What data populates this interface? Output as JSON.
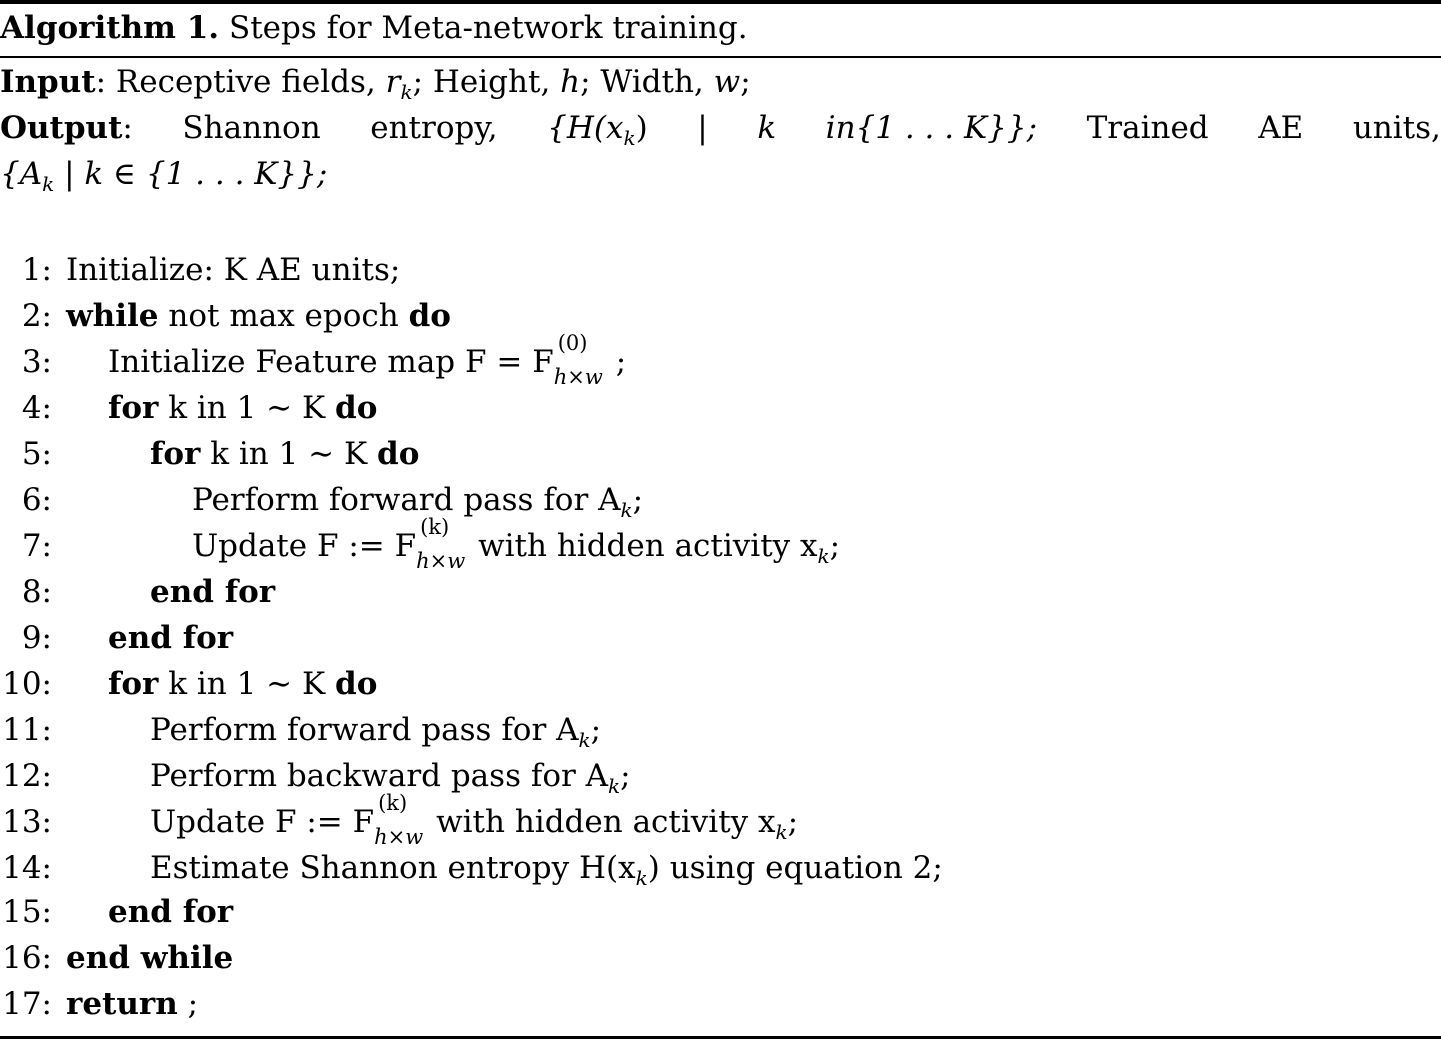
{
  "caption": {
    "label": "Algorithm 1.",
    "text": "Steps for Meta-network training."
  },
  "input": {
    "label": "Input",
    "parts": [
      "Receptive fields,",
      "r",
      "k",
      "; Height,",
      "h",
      "; Width,",
      "w",
      ";"
    ]
  },
  "output": {
    "label": "Output",
    "line1": [
      "Shannon",
      "entropy,",
      "{H(x",
      "k",
      ")",
      "|",
      "k",
      "in{1 . . . K}};",
      "Trained",
      "AE",
      "units,"
    ],
    "line2": [
      "{A",
      "k",
      "| k ∈ {1 . . . K}};"
    ]
  },
  "steps": [
    {
      "num": "1:",
      "text": "Initialize: K AE units;"
    },
    {
      "num": "2:",
      "kw1": "while",
      "text": "not max epoch",
      "kw2": "do"
    },
    {
      "num": "3:",
      "text": "Initialize Feature map F = F",
      "sup": "(0)",
      "sub": "h×w",
      "tail": ";"
    },
    {
      "num": "4:",
      "kw1": "for",
      "text": "k in 1 ∼ K",
      "kw2": "do"
    },
    {
      "num": "5:",
      "kw1": "for",
      "text": "k in 1 ∼ K",
      "kw2": "do"
    },
    {
      "num": "6:",
      "text": "Perform forward pass for A",
      "subk": "k",
      "tail": ";"
    },
    {
      "num": "7:",
      "text": "Update F := F",
      "sup": "(k)",
      "sub": "h×w",
      "tail": "with hidden activity x",
      "subk": "k",
      "end": ";"
    },
    {
      "num": "8:",
      "kw1": "end for"
    },
    {
      "num": "9:",
      "kw1": "end for"
    },
    {
      "num": "10:",
      "kw1": "for",
      "text": "k in 1 ∼ K",
      "kw2": "do"
    },
    {
      "num": "11:",
      "text": "Perform forward pass for A",
      "subk": "k",
      "tail": ";"
    },
    {
      "num": "12:",
      "text": "Perform backward pass for A",
      "subk": "k",
      "tail": ";"
    },
    {
      "num": "13:",
      "text": "Update F := F",
      "sup": "(k)",
      "sub": "h×w",
      "tail": "with hidden activity x",
      "subk": "k",
      "end": ";"
    },
    {
      "num": "14:",
      "text": "Estimate Shannon entropy H(x",
      "subk": "k",
      "tail": ") using equation 2;"
    },
    {
      "num": "15:",
      "kw1": "end for"
    },
    {
      "num": "16:",
      "kw1": "end while"
    },
    {
      "num": "17:",
      "kw1": "return",
      "text": ";"
    }
  ]
}
